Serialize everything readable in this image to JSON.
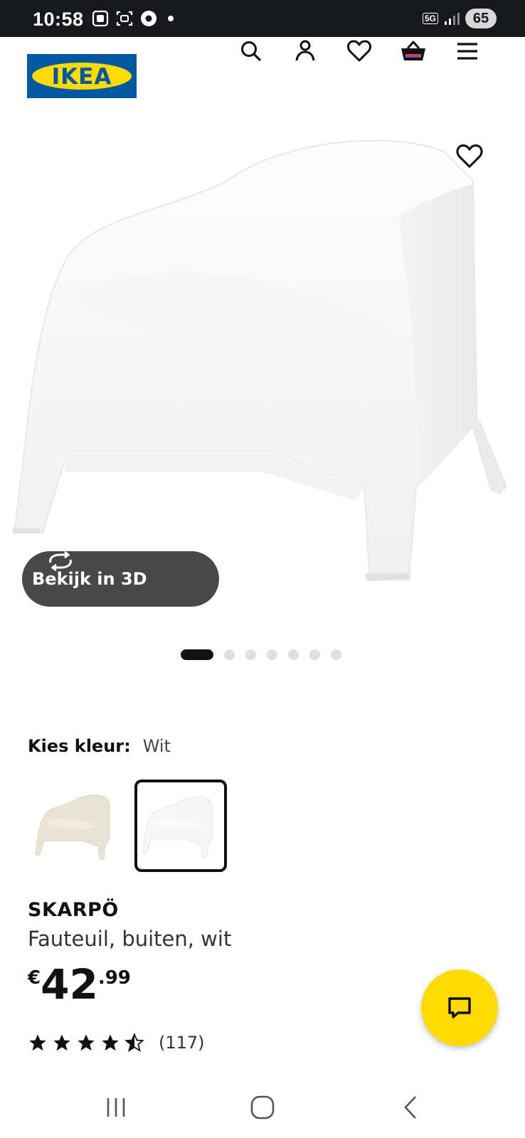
{
  "status_bar": {
    "time": "10:58",
    "network": "5G",
    "battery": "65"
  },
  "header": {
    "logo_text": "IKEA",
    "icons": [
      "search-icon",
      "user-icon",
      "heart-icon",
      "basket-icon",
      "menu-icon"
    ]
  },
  "gallery": {
    "view_3d_label": "Bekijk in 3D",
    "dot_count": 7,
    "active_dot": 0
  },
  "color_picker": {
    "label": "Kies kleur:",
    "selected": "Wit",
    "options": [
      "beige",
      "wit"
    ],
    "selected_index": 1
  },
  "product": {
    "name": "SKARPÖ",
    "description": "Fauteuil, buiten, wit",
    "price_currency": "€",
    "price_integer": "42",
    "price_decimal": ".99",
    "rating_value": 4.5,
    "rating_count": "(117)"
  },
  "colors": {
    "ikea_blue": "#0058a3",
    "ikea_yellow": "#ffdb00",
    "status_bar_bg": "#17181c",
    "view3d_bg": "#484848"
  }
}
